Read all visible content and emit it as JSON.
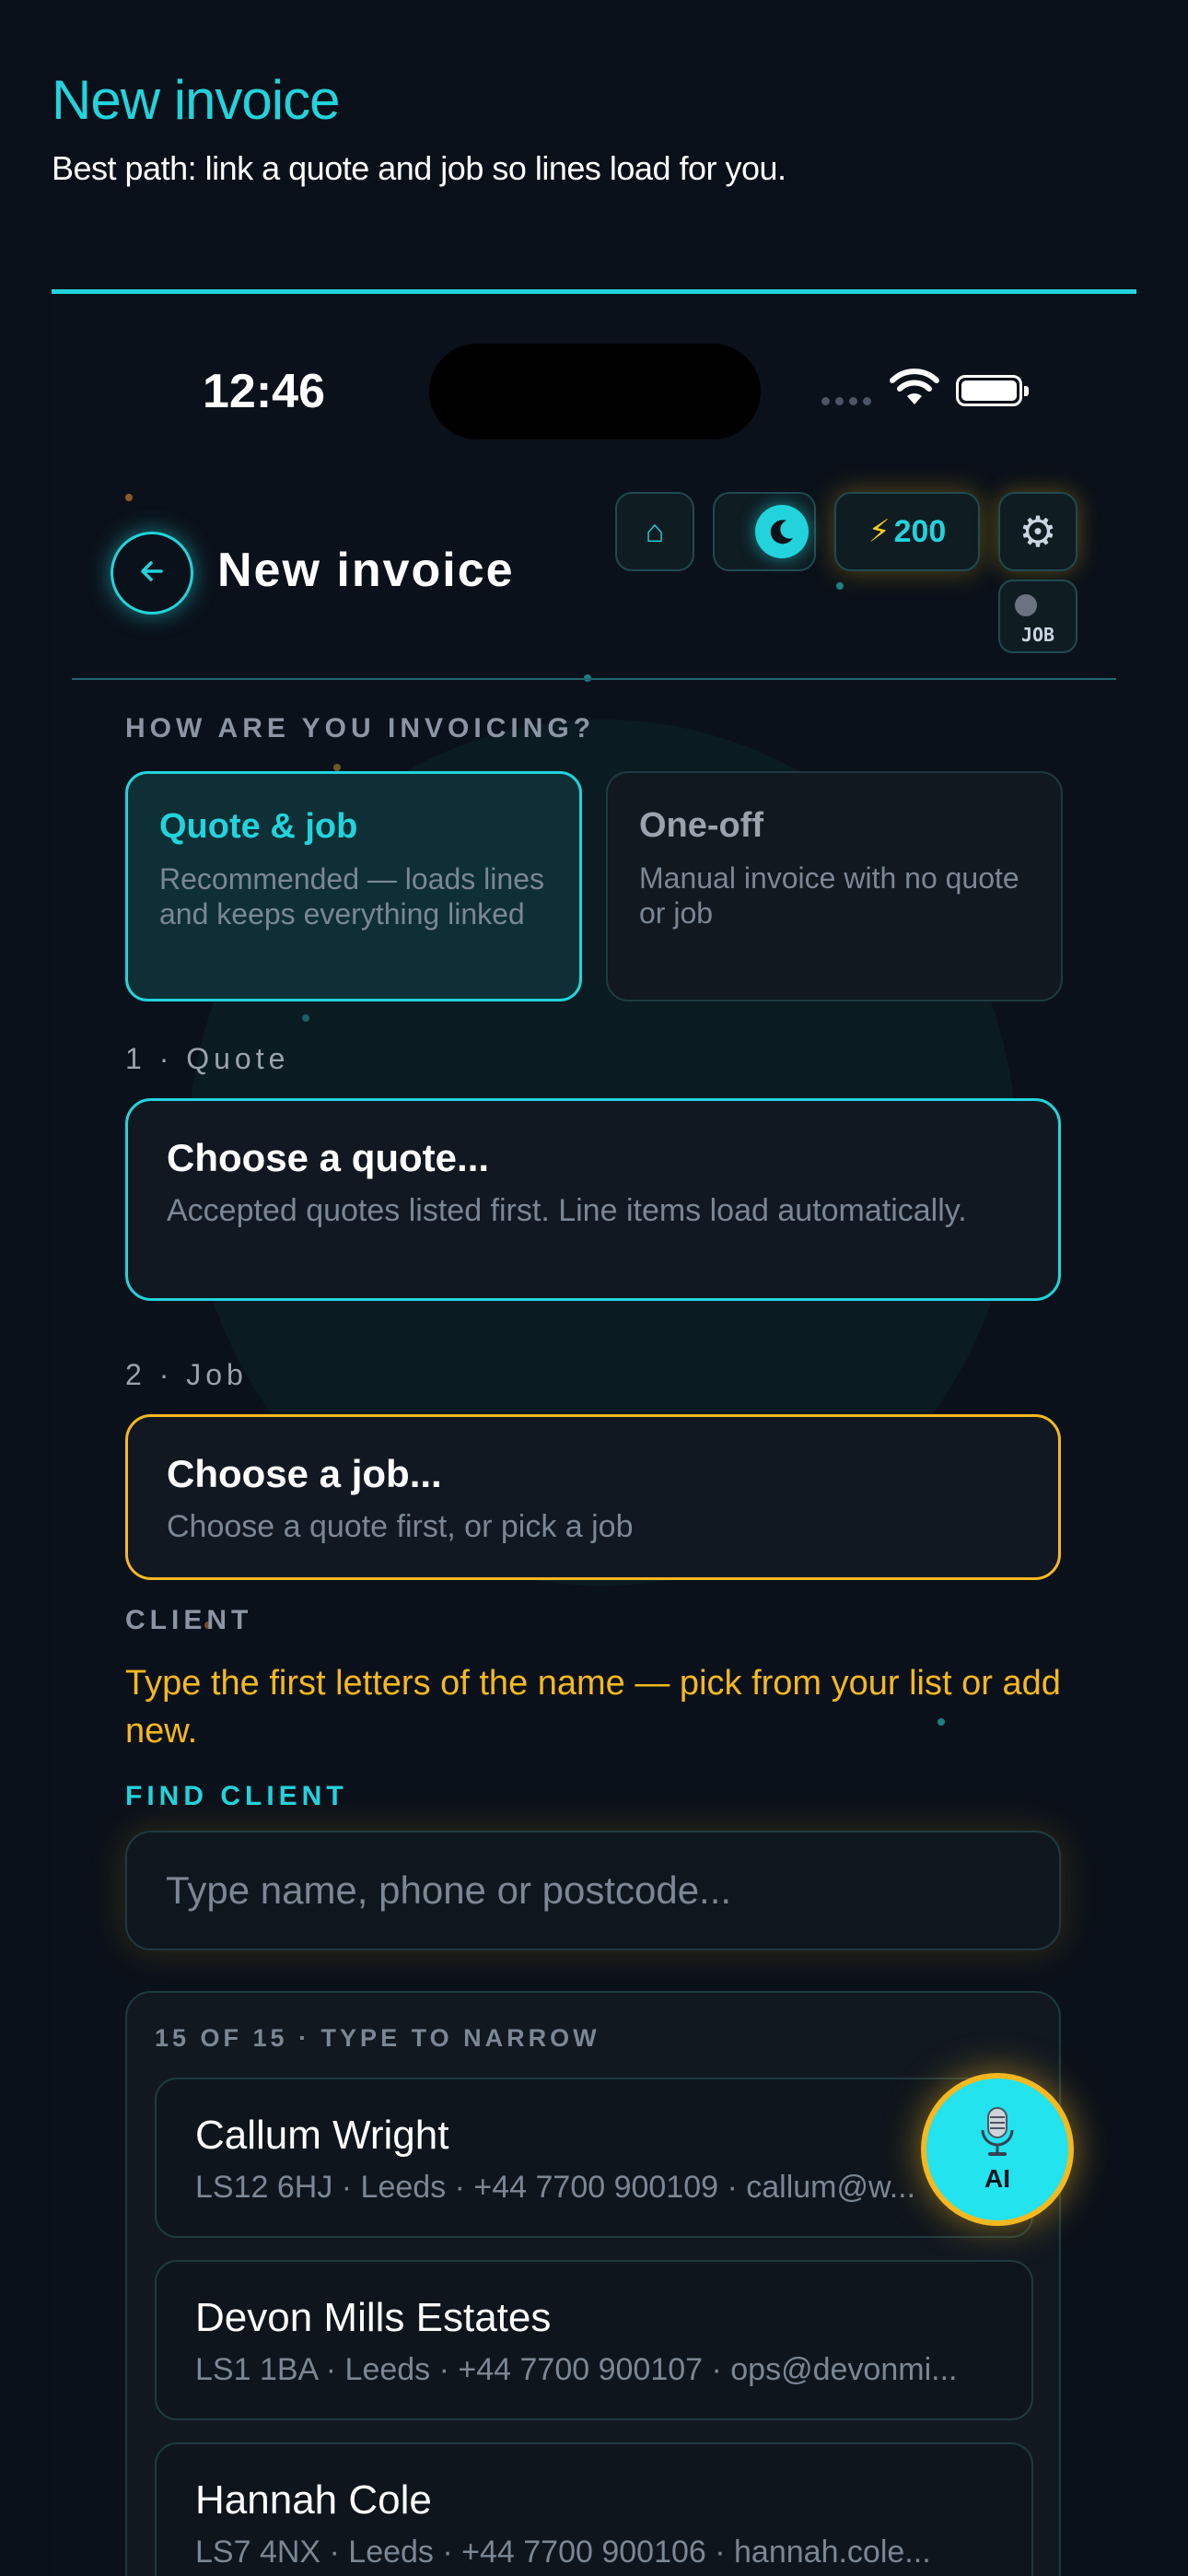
{
  "page": {
    "heading": "New invoice",
    "subheading": "Best path: link a quote and job so lines load for you."
  },
  "status_bar": {
    "time": "12:46"
  },
  "header": {
    "title": "New invoice",
    "back_icon": "arrow-left-icon",
    "toolbar": {
      "home_icon": "⌂",
      "theme_icon": "moon-icon",
      "credits_icon": "⚡",
      "credits_value": "200",
      "settings_icon": "⚙",
      "job_toggle_label": "JOB"
    }
  },
  "invoicing_mode": {
    "label": "HOW ARE YOU INVOICING?",
    "options": [
      {
        "title": "Quote & job",
        "description": "Recommended — loads lines and keeps everything linked",
        "selected": true
      },
      {
        "title": "One-off",
        "description": "Manual invoice with no quote or job",
        "selected": false
      }
    ]
  },
  "quote_step": {
    "label": "1 · Quote",
    "title": "Choose a quote...",
    "description": "Accepted quotes listed first. Line items load automatically."
  },
  "job_step": {
    "label": "2 · Job",
    "title": "Choose a job...",
    "description": "Choose a quote first, or pick a job"
  },
  "client": {
    "label": "CLIENT",
    "hint": "Type the first letters of the name — pick from your list or add new.",
    "find_label": "FIND CLIENT",
    "search_placeholder": "Type name, phone or postcode...",
    "search_value": "",
    "results_count": "15 OF 15 · TYPE TO NARROW",
    "results": [
      {
        "name": "Callum Wright",
        "meta": "LS12 6HJ · Leeds · +44 7700 900109 · callum@w..."
      },
      {
        "name": "Devon Mills Estates",
        "meta": "LS1 1BA · Leeds · +44 7700 900107 · ops@devonmi..."
      },
      {
        "name": "Hannah Cole",
        "meta": "LS7 4NX · Leeds · +44 7700 900106 · hannah.cole..."
      }
    ]
  },
  "ai_button": {
    "icon": "microphone-icon",
    "label": "AI"
  },
  "colors": {
    "accent": "#22d3dc",
    "warning": "#f5b820",
    "background": "#0a1019"
  }
}
